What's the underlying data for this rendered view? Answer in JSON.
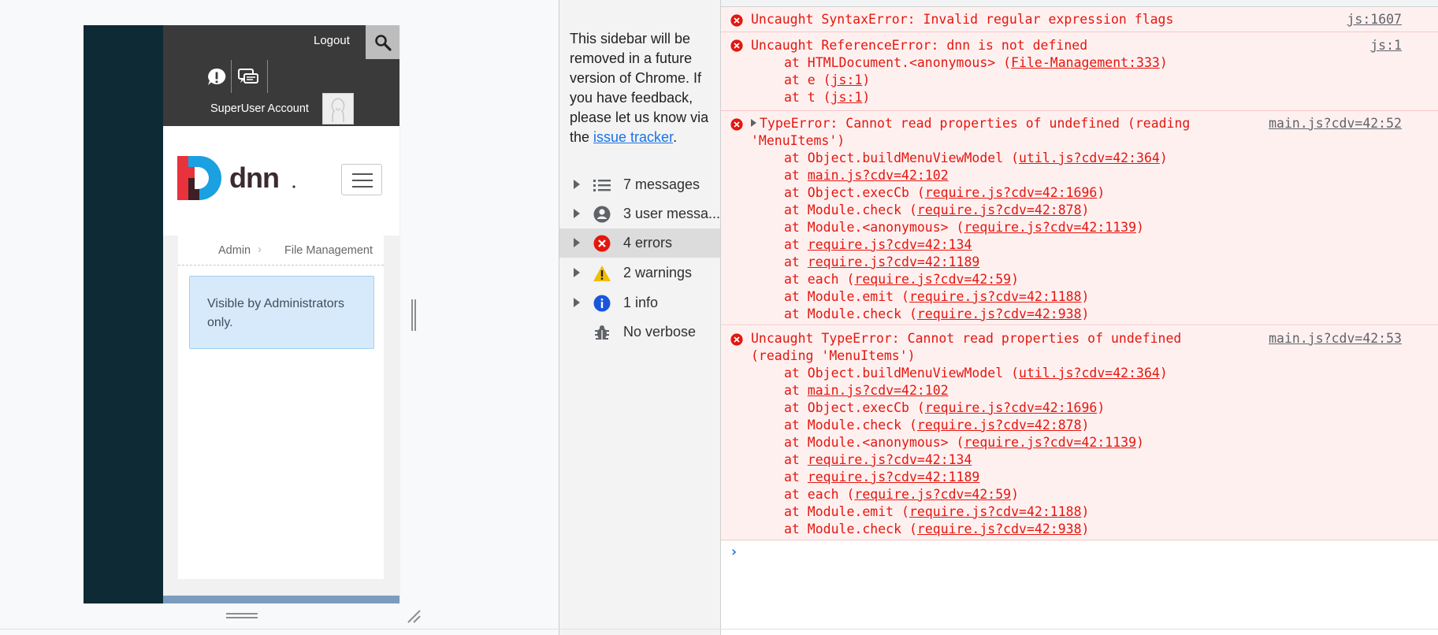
{
  "device_preview": {
    "topbar": {
      "logout_label": "Logout",
      "user_name": "SuperUser Account"
    },
    "icons": {
      "search": "search-icon",
      "notifications": "exclamation-bubble-icon",
      "messages": "chat-bubbles-icon",
      "avatar": "default-avatar-icon"
    },
    "breadcrumb": {
      "items": [
        "Admin",
        "File Management"
      ],
      "separator": "›"
    },
    "notice": {
      "text": "Visible by Administrators only."
    },
    "colors": {
      "sidebar": "#0e2a35",
      "topbar": "#3a3a3a",
      "notice_bg": "#d7eafb",
      "bottom_bar": "#7b9cbc",
      "logo_red": "#e8323c",
      "logo_blue": "#1ba0e2",
      "logo_dark": "#3b1f24"
    }
  },
  "console_sidebar": {
    "deprecation_text": "This sidebar will be removed in a future version of Chrome. If you have feedback, please let us know via the ",
    "deprecation_link": "issue tracker",
    "deprecation_end": ".",
    "categories": [
      {
        "label": "7 messages",
        "icon": "list-icon",
        "expandable": true,
        "selected": false
      },
      {
        "label": "3 user messa...",
        "icon": "user-icon",
        "expandable": true,
        "selected": false
      },
      {
        "label": "4 errors",
        "icon": "error-icon",
        "expandable": true,
        "selected": true
      },
      {
        "label": "2 warnings",
        "icon": "warning-icon",
        "expandable": true,
        "selected": false
      },
      {
        "label": "1 info",
        "icon": "info-icon",
        "expandable": true,
        "selected": false
      },
      {
        "label": "No verbose",
        "icon": "bug-icon",
        "expandable": false,
        "selected": false
      }
    ]
  },
  "console_messages": [
    {
      "lines": [
        "Uncaught SyntaxError: Invalid regular expression flags"
      ],
      "source": "js:1607",
      "stack": []
    },
    {
      "lines": [
        "Uncaught ReferenceError: dnn is not defined"
      ],
      "source": "js:1",
      "stack": [
        {
          "prefix": "at HTMLDocument.<anonymous> (",
          "link": "File-Management:333",
          "suffix": ")"
        },
        {
          "prefix": "at e (",
          "link": "js:1",
          "suffix": ")"
        },
        {
          "prefix": "at t (",
          "link": "js:1",
          "suffix": ")"
        }
      ]
    },
    {
      "lines": [
        "TypeError: Cannot read properties of undefined (reading",
        "'MenuItems')"
      ],
      "expandable": true,
      "source": "main.js?cdv=42:52",
      "stack": [
        {
          "prefix": "at Object.buildMenuViewModel (",
          "link": "util.js?cdv=42:364",
          "suffix": ")"
        },
        {
          "prefix": "at ",
          "link": "main.js?cdv=42:102",
          "suffix": ""
        },
        {
          "prefix": "at Object.execCb (",
          "link": "require.js?cdv=42:1696",
          "suffix": ")"
        },
        {
          "prefix": "at Module.check (",
          "link": "require.js?cdv=42:878",
          "suffix": ")"
        },
        {
          "prefix": "at Module.<anonymous> (",
          "link": "require.js?cdv=42:1139",
          "suffix": ")"
        },
        {
          "prefix": "at ",
          "link": "require.js?cdv=42:134",
          "suffix": ""
        },
        {
          "prefix": "at ",
          "link": "require.js?cdv=42:1189",
          "suffix": ""
        },
        {
          "prefix": "at each (",
          "link": "require.js?cdv=42:59",
          "suffix": ")"
        },
        {
          "prefix": "at Module.emit (",
          "link": "require.js?cdv=42:1188",
          "suffix": ")"
        },
        {
          "prefix": "at Module.check (",
          "link": "require.js?cdv=42:938",
          "suffix": ")"
        }
      ]
    },
    {
      "lines": [
        "Uncaught TypeError: Cannot read properties of undefined",
        "(reading 'MenuItems')"
      ],
      "source": "main.js?cdv=42:53",
      "stack": [
        {
          "prefix": "at Object.buildMenuViewModel (",
          "link": "util.js?cdv=42:364",
          "suffix": ")"
        },
        {
          "prefix": "at ",
          "link": "main.js?cdv=42:102",
          "suffix": ""
        },
        {
          "prefix": "at Object.execCb (",
          "link": "require.js?cdv=42:1696",
          "suffix": ")"
        },
        {
          "prefix": "at Module.check (",
          "link": "require.js?cdv=42:878",
          "suffix": ")"
        },
        {
          "prefix": "at Module.<anonymous> (",
          "link": "require.js?cdv=42:1139",
          "suffix": ")"
        },
        {
          "prefix": "at ",
          "link": "require.js?cdv=42:134",
          "suffix": ""
        },
        {
          "prefix": "at ",
          "link": "require.js?cdv=42:1189",
          "suffix": ""
        },
        {
          "prefix": "at each (",
          "link": "require.js?cdv=42:59",
          "suffix": ")"
        },
        {
          "prefix": "at Module.emit (",
          "link": "require.js?cdv=42:1188",
          "suffix": ")"
        },
        {
          "prefix": "at Module.check (",
          "link": "require.js?cdv=42:938",
          "suffix": ")"
        }
      ]
    }
  ],
  "prompt_symbol": "›",
  "colors": {
    "error_text": "#e3170f",
    "error_bg": "#fff0f0",
    "link": "#1a73e8"
  }
}
